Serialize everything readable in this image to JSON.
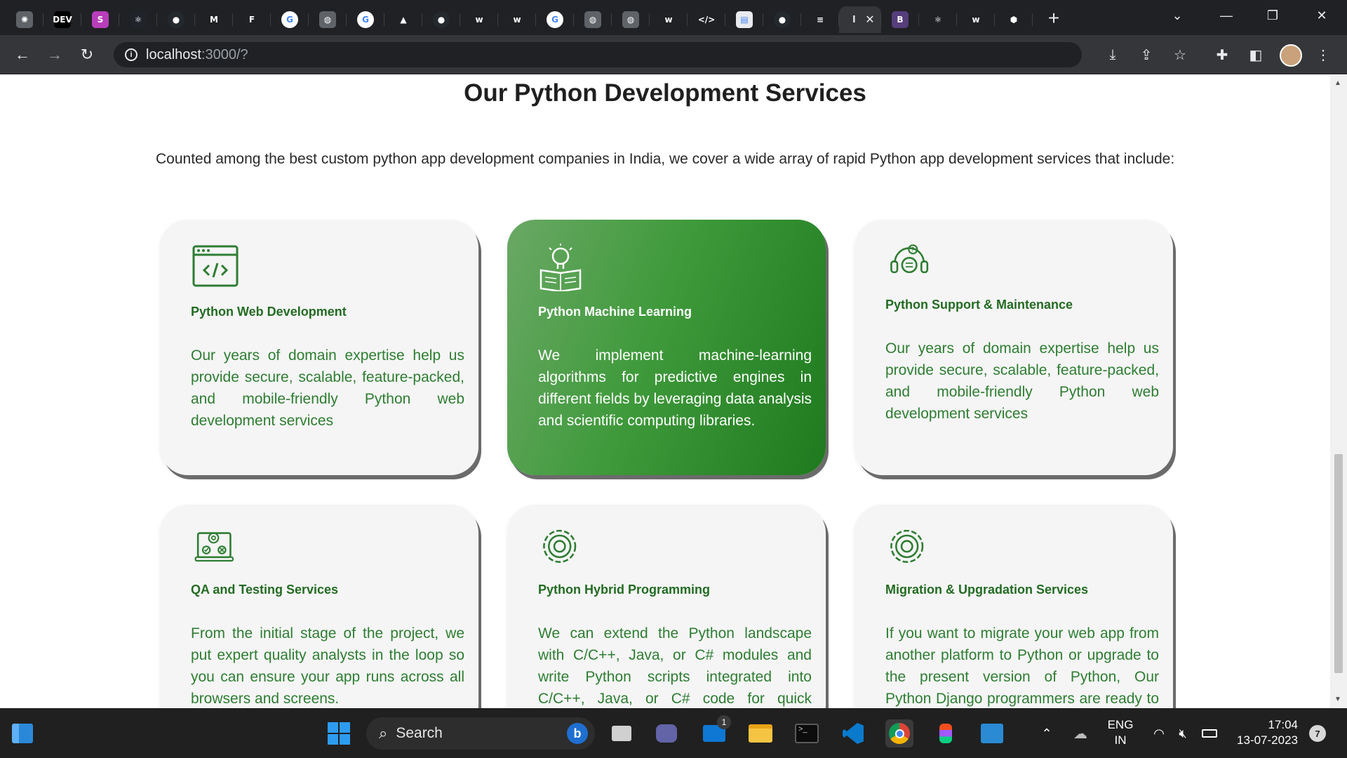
{
  "browser": {
    "tabs": [
      {
        "icon": "openai-icon",
        "color": "#5f6368",
        "glyph": "✺"
      },
      {
        "icon": "dev-icon",
        "color": "#000000",
        "glyph": "DEV"
      },
      {
        "icon": "slack-icon",
        "color": "#b83dba",
        "glyph": "S"
      },
      {
        "icon": "react-icon",
        "color": "#20232a",
        "glyph": "⚛"
      },
      {
        "icon": "github-icon",
        "color": "#24292e",
        "glyph": "●"
      },
      {
        "icon": "gmail-icon",
        "color": "#202124",
        "glyph": "M"
      },
      {
        "icon": "figma-icon",
        "color": "#202124",
        "glyph": "F"
      },
      {
        "icon": "google-icon",
        "color": "#ffffff",
        "glyph": "G"
      },
      {
        "icon": "globe-icon",
        "color": "#5f6368",
        "glyph": "◍"
      },
      {
        "icon": "google-icon",
        "color": "#ffffff",
        "glyph": "G"
      },
      {
        "icon": "drive-icon",
        "color": "#202124",
        "glyph": "▲"
      },
      {
        "icon": "github-icon",
        "color": "#24292e",
        "glyph": "●"
      },
      {
        "icon": "w3-icon",
        "color": "#202124",
        "glyph": "w"
      },
      {
        "icon": "w3-icon",
        "color": "#202124",
        "glyph": "w"
      },
      {
        "icon": "google-icon",
        "color": "#ffffff",
        "glyph": "G"
      },
      {
        "icon": "globe-icon",
        "color": "#5f6368",
        "glyph": "◍"
      },
      {
        "icon": "globe-icon",
        "color": "#5f6368",
        "glyph": "◍"
      },
      {
        "icon": "w3-icon",
        "color": "#202124",
        "glyph": "w"
      },
      {
        "icon": "code-icon",
        "color": "#202124",
        "glyph": "</>"
      },
      {
        "icon": "doc-icon",
        "color": "#e8eaed",
        "glyph": "▤"
      },
      {
        "icon": "github-icon",
        "color": "#24292e",
        "glyph": "●"
      },
      {
        "icon": "stackoverflow-icon",
        "color": "#202124",
        "glyph": "≡"
      }
    ],
    "active_tab_glyph": "l",
    "active_tab_close": "✕",
    "tabs_after": [
      {
        "icon": "bootstrap-icon",
        "color": "#563d7c",
        "glyph": "B"
      },
      {
        "icon": "react-icon",
        "color": "#202124",
        "glyph": "⚛"
      },
      {
        "icon": "w3-icon",
        "color": "#202124",
        "glyph": "w"
      },
      {
        "icon": "codepen-icon",
        "color": "#202124",
        "glyph": "⬢"
      }
    ],
    "new_tab": "+",
    "url_host": "localhost",
    "url_path": ":3000/?"
  },
  "page": {
    "heading": "Our Python Development Services",
    "intro": "Counted among the best custom python app development companies in India, we cover a wide array of rapid Python app development services that include:",
    "cards": [
      {
        "icon": "code-window-icon",
        "title": "Python Web Development",
        "desc": "Our years of domain expertise help us provide secure, scalable, feature-packed, and mobile-friendly Python web development services"
      },
      {
        "icon": "lightbulb-book-icon",
        "title": "Python Machine Learning",
        "desc": "We implement machine-learning algorithms for predictive engines in different fields by leveraging data analysis and scientific computing libraries."
      },
      {
        "icon": "headset-support-icon",
        "title": "Python Support & Maintenance",
        "desc": "Our years of domain expertise help us provide secure, scalable, feature-packed, and mobile-friendly Python web development services"
      },
      {
        "icon": "qa-testing-icon",
        "title": "QA and Testing Services",
        "desc": "From the initial stage of the project, we put expert quality analysts in the loop so you can ensure your app runs across all browsers and screens."
      },
      {
        "icon": "gear-icon",
        "title": "Python Hybrid Programming",
        "desc": "We can extend the Python landscape with C/C++, Java, or C# modules and write Python scripts integrated into C/C++, Java, or C# code for quick customizations."
      },
      {
        "icon": "gear-icon",
        "title": "Migration & Upgradation Services",
        "desc": "If you want to migrate your web app from another platform to Python or upgrade to the present version of Python, Our Python Django programmers are ready to help"
      }
    ]
  },
  "taskbar": {
    "search_label": "Search",
    "lang_top": "ENG",
    "lang_bottom": "IN",
    "time": "17:04",
    "date": "13-07-2023",
    "notification_count": "7",
    "mail_badge": "1"
  },
  "colors": {
    "accent_green": "#2e7d32",
    "card_bg": "#f5f5f5"
  }
}
